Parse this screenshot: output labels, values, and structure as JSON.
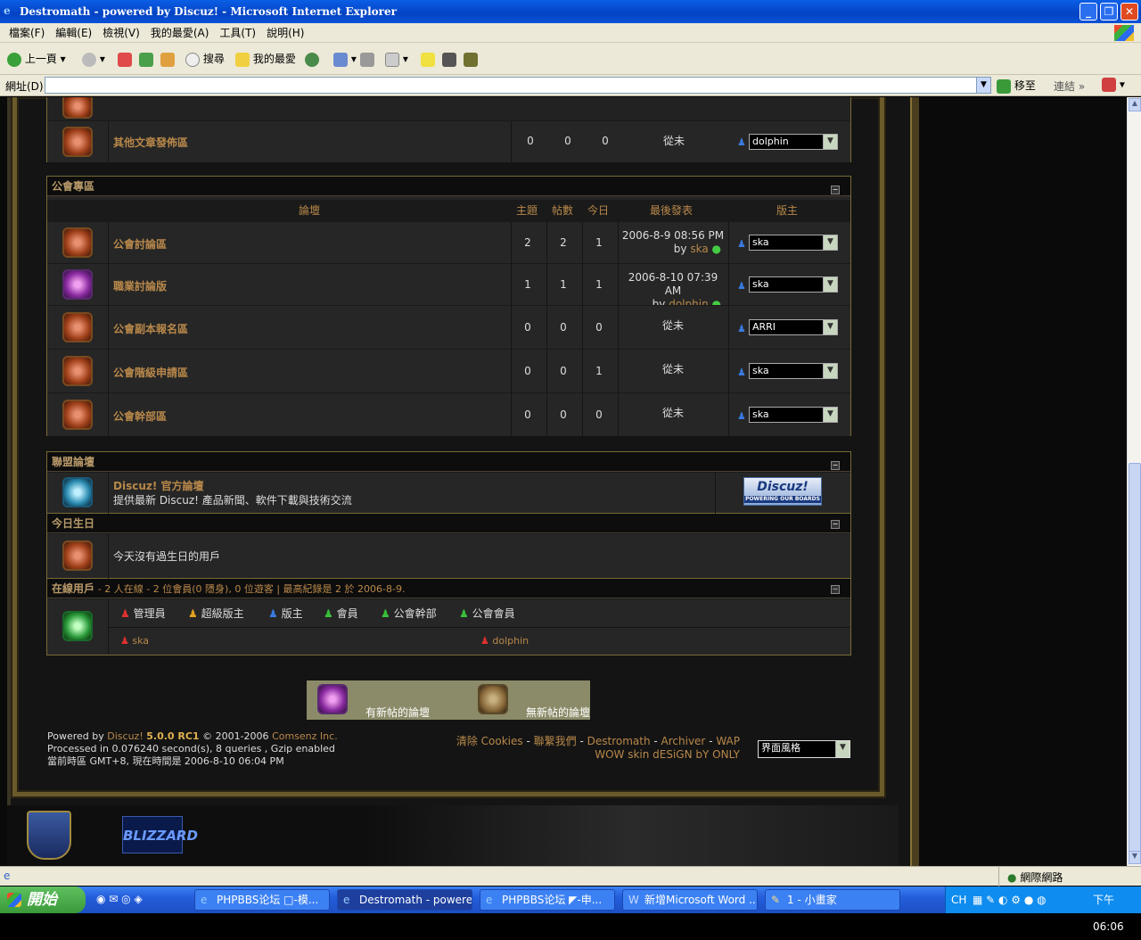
{
  "window": {
    "title": "Destromath - powered by Discuz! - Microsoft Internet Explorer"
  },
  "menu": [
    "檔案(F)",
    "編輯(E)",
    "檢視(V)",
    "我的最愛(A)",
    "工具(T)",
    "說明(H)"
  ],
  "toolbar": {
    "back": "上一頁",
    "search": "搜尋",
    "favorites": "我的最愛"
  },
  "address": {
    "label": "網址(D)",
    "value": "",
    "go": "移至",
    "links": "連結"
  },
  "top_forum": {
    "name": "其他文章發佈區",
    "topics": "0",
    "posts": "0",
    "today": "0",
    "last": "從未",
    "moderator": "dolphin"
  },
  "guild": {
    "title": "公會專區",
    "headers": {
      "forum": "論壇",
      "topics": "主題",
      "posts": "帖數",
      "today": "今日",
      "last": "最後發表",
      "mods": "版主"
    },
    "forums": [
      {
        "name": "公會討論區",
        "topics": "2",
        "posts": "2",
        "today": "1",
        "last_date": "2006-8-9 08:56 PM",
        "last_by": "ska",
        "moderator": "ska"
      },
      {
        "name": "職業討論版",
        "topics": "1",
        "posts": "1",
        "today": "1",
        "last_date": "2006-8-10 07:39 AM",
        "last_by": "dolphin",
        "moderator": "ska"
      },
      {
        "name": "公會副本報名區",
        "topics": "0",
        "posts": "0",
        "today": "0",
        "last": "從未",
        "moderator": "ARRI"
      },
      {
        "name": "公會階級申請區",
        "topics": "0",
        "posts": "0",
        "today": "1",
        "last": "從未",
        "moderator": "ska"
      },
      {
        "name": "公會幹部區",
        "topics": "0",
        "posts": "0",
        "today": "0",
        "last": "從未",
        "moderator": "ska"
      }
    ],
    "by_prefix": "by"
  },
  "alliance": {
    "title": "聯盟論壇",
    "name": "Discuz! 官方論壇",
    "desc": "提供最新 Discuz! 產品新聞、軟件下載與技術交流",
    "logo": "Discuz!",
    "logo_sub": "POWERING OUR BOARDS"
  },
  "birthday": {
    "title": "今日生日",
    "text": "今天沒有過生日的用戶"
  },
  "online": {
    "title": "在線用戶",
    "summary": "- 2 人在線 - 2 位會員(0 隱身), 0 位遊客 | 最高紀錄是 2 於 2006-8-9.",
    "legend": [
      "管理員",
      "超級版主",
      "版主",
      "會員",
      "公會幹部",
      "公會會員"
    ],
    "users": [
      "ska",
      "dolphin"
    ]
  },
  "legend_box": {
    "new": "有新帖的論壇",
    "nonew": "無新帖的論壇"
  },
  "footer": {
    "powered": "Powered by",
    "product": "Discuz!",
    "version": "5.0.0 RC1",
    "copyright": "© 2001-2006",
    "company": "Comsenz Inc.",
    "processed": "Processed in 0.076240 second(s), 8 queries , Gzip enabled",
    "time": "當前時區 GMT+8, 現在時間是 2006-8-10 06:04 PM",
    "links": [
      "清除 Cookies",
      "聯繫我們",
      "Destromath",
      "Archiver",
      "WAP"
    ],
    "skin": "WOW skin dESiGN bY ONLY",
    "style_select": "界面風格"
  },
  "brand": {
    "blizzard": "BLIZZARD"
  },
  "status": {
    "zone": "網際網路"
  },
  "taskbar": {
    "start": "開始",
    "tasks": [
      "PHPBBS论坛 □-模...",
      "Destromath - powered ...",
      "PHPBBS论坛 ◤-申...",
      "新增Microsoft Word ...",
      "1 - 小畫家"
    ],
    "lang": "CH",
    "clock": "下午 06:06"
  }
}
